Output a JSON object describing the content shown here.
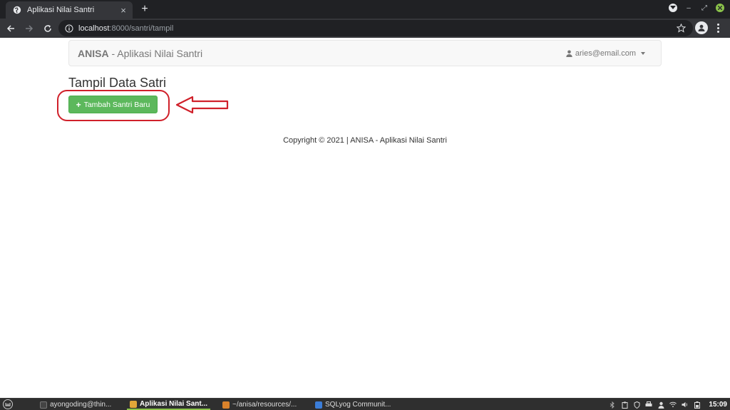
{
  "browser": {
    "tab_title": "Aplikasi Nilai Santri",
    "tab_close": "×",
    "new_tab": "+",
    "url_host": "localhost",
    "url_path": ":8000/santri/tampil"
  },
  "navbar": {
    "brand": "ANISA",
    "brand_sub": " - Aplikasi Nilai Santri",
    "user_email": "aries@email.com"
  },
  "main": {
    "page_title": "Tampil Data Satri",
    "add_button_label": "Tambah Santri Baru",
    "add_button_icon": "+"
  },
  "footer": {
    "copyright": "Copyright © 2021 | ANISA - Aplikasi Nilai Santri"
  },
  "taskbar": {
    "tasks": [
      {
        "label": "ayongoding@thin..."
      },
      {
        "label": "Aplikasi Nilai Sant..."
      },
      {
        "label": "~/anisa/resources/..."
      },
      {
        "label": "SQLyog Communit..."
      }
    ],
    "clock": "15:09"
  },
  "colors": {
    "success": "#5cb85c",
    "annotation": "#d0202a",
    "chrome_dark": "#202124"
  }
}
